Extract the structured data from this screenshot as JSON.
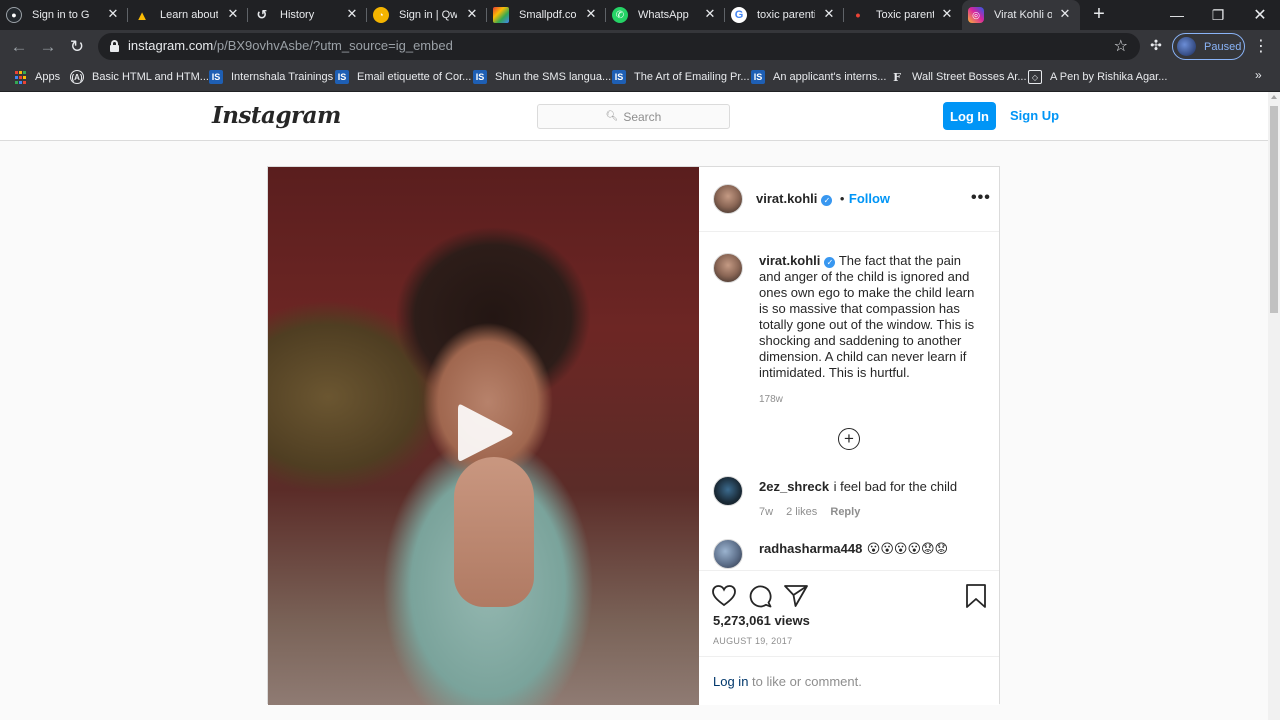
{
  "browser": {
    "tabs": [
      {
        "title": "Sign in to GitHub",
        "icon": "github-icon",
        "color": "#24292e",
        "glyph": "◉"
      },
      {
        "title": "Learn about HTML",
        "icon": "google-drive-icon",
        "color": "#fbbc04",
        "glyph": "▲"
      },
      {
        "title": "History",
        "icon": "history-icon",
        "color": "#202124",
        "glyph": "↺"
      },
      {
        "title": "Sign in | Qwiklabs",
        "icon": "qwiklabs-icon",
        "color": "#f4b400",
        "glyph": "●"
      },
      {
        "title": "Smallpdf.com",
        "icon": "smallpdf-icon",
        "color": "#e53935",
        "glyph": "■"
      },
      {
        "title": "WhatsApp",
        "icon": "whatsapp-icon",
        "color": "#25d366",
        "glyph": "✆"
      },
      {
        "title": "toxic parenting",
        "icon": "google-icon",
        "color": "#ffffff",
        "glyph": "G"
      },
      {
        "title": "Toxic parenting",
        "icon": "loading-icon",
        "color": "#ea4335",
        "glyph": "•"
      },
      {
        "title": "Virat Kohli on Instagram",
        "icon": "instagram-icon",
        "color": "#d6249f",
        "glyph": "◎"
      }
    ],
    "url_host": "instagram.com",
    "url_rest": "/p/BX9ovhvAsbe/?utm_source=ig_embed",
    "profile_status": "Paused",
    "bookmarks": [
      {
        "label": "Apps",
        "icon": "apps-grid-icon"
      },
      {
        "label": "Basic HTML and HTM...",
        "icon": "freecodecamp-icon"
      },
      {
        "label": "Internshala Trainings",
        "icon": "internshala-icon"
      },
      {
        "label": "Email etiquette of Cor...",
        "icon": "internshala-icon"
      },
      {
        "label": "Shun the SMS langua...",
        "icon": "internshala-icon"
      },
      {
        "label": "The Art of Emailing Pr...",
        "icon": "internshala-icon"
      },
      {
        "label": "An applicant's interns...",
        "icon": "internshala-icon"
      },
      {
        "label": "Wall Street Bosses Ar...",
        "icon": "forbes-icon"
      },
      {
        "label": "A Pen by Rishika Agar...",
        "icon": "codepen-icon"
      }
    ]
  },
  "instagram": {
    "logo": "Instagram",
    "search_placeholder": "Search",
    "login_label": "Log In",
    "signup_label": "Sign Up"
  },
  "post": {
    "username": "virat.kohli",
    "follow_label": "Follow",
    "follow_separator": "•",
    "caption": "The fact that the pain and anger of the child is ignored and ones own ego to make the child learn is so massive that compassion has totally gone out of the window. This is shocking and saddening to another dimension. A child can never learn if intimidated. This is hurtful.",
    "caption_age": "178w",
    "comments": [
      {
        "user": "2ez_shreck",
        "text": "i feel bad for the child",
        "age": "7w",
        "likes": "2 likes",
        "reply": "Reply"
      },
      {
        "user": "radhasharma448",
        "text": "😮😮😮😮😟😟"
      }
    ],
    "views": "5,273,061 views",
    "date": "AUGUST 19, 2017",
    "login_link": "Log in",
    "login_suffix": " to like or comment."
  }
}
